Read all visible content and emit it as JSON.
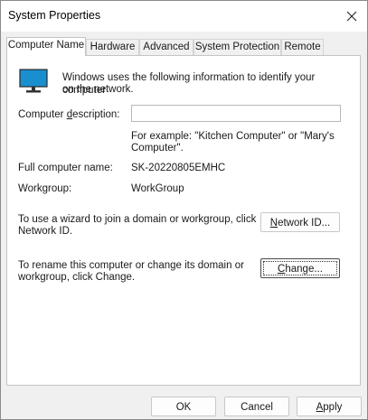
{
  "window": {
    "title": "System Properties"
  },
  "tabs": [
    {
      "label": "Computer Name",
      "active": true
    },
    {
      "label": "Hardware",
      "active": false
    },
    {
      "label": "Advanced",
      "active": false
    },
    {
      "label": "System Protection",
      "active": false
    },
    {
      "label": "Remote",
      "active": false
    }
  ],
  "computer_name_tab": {
    "intro_line1": "Windows uses the following information to identify your computer",
    "intro_line2": "on the network.",
    "description_label_pre": "Computer ",
    "description_label_accel": "d",
    "description_label_post": "escription:",
    "description_value": "",
    "example_line1": "For example: \"Kitchen Computer\" or \"Mary's",
    "example_line2": "Computer\".",
    "full_name_label": "Full computer name:",
    "full_name_value": "SK-20220805EMHC",
    "workgroup_label": "Workgroup:",
    "workgroup_value": "WorkGroup",
    "wizard_line1": "To use a wizard to join a domain or workgroup, click",
    "wizard_line2": "Network ID.",
    "network_id_button_pre": "",
    "network_id_button_accel": "N",
    "network_id_button_post": "etwork ID...",
    "rename_line1": "To rename this computer or change its domain or",
    "rename_line2": "workgroup, click Change.",
    "change_button_pre": "",
    "change_button_accel": "C",
    "change_button_post": "hange..."
  },
  "footer": {
    "ok_label": "OK",
    "cancel_label": "Cancel",
    "apply_pre": "",
    "apply_accel": "A",
    "apply_post": "pply"
  },
  "icons": {
    "title_close": "close-icon",
    "computer": "monitor-icon"
  },
  "colors": {
    "monitor_screen": "#1a8fcf",
    "window_bg": "#f0f0f0",
    "panel_bg": "#ffffff"
  }
}
